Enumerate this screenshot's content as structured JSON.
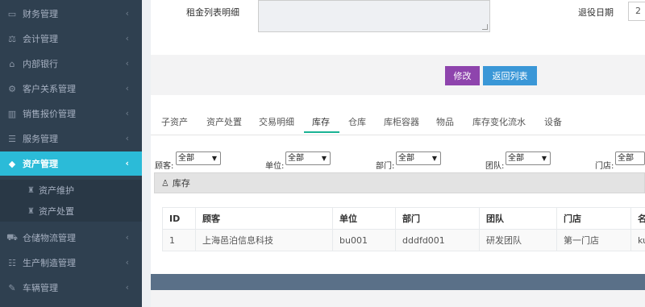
{
  "sidebar": {
    "items": [
      {
        "label": "财务管理",
        "icon": "money-icon"
      },
      {
        "label": "会计管理",
        "icon": "scale-icon"
      },
      {
        "label": "内部银行",
        "icon": "bank-icon"
      },
      {
        "label": "客户关系管理",
        "icon": "gears-icon"
      },
      {
        "label": "销售报价管理",
        "icon": "bar-chart-icon"
      },
      {
        "label": "服务管理",
        "icon": "list-icon"
      },
      {
        "label": "资产管理",
        "icon": "diamond-icon"
      },
      {
        "label": "仓储物流管理",
        "icon": "truck-icon"
      },
      {
        "label": "生产制造管理",
        "icon": "sliders-icon"
      },
      {
        "label": "车辆管理",
        "icon": "edit-icon"
      }
    ],
    "subitems": [
      {
        "label": "资产维护",
        "icon": "trophy-icon"
      },
      {
        "label": "资产处置",
        "icon": "trophy-icon"
      }
    ],
    "chevron": "‹"
  },
  "form": {
    "rent_detail_label": "租金列表明细",
    "retire_date_label": "退役日期",
    "retire_date_value": "2"
  },
  "actions": {
    "edit": "修改",
    "back": "返回列表"
  },
  "tabs": [
    "子资产",
    "资产处置",
    "交易明细",
    "库存",
    "仓库",
    "库柜容器",
    "物品",
    "库存变化流水",
    "设备"
  ],
  "active_tab": "库存",
  "filters": [
    {
      "label": "顾客:",
      "value": "全部"
    },
    {
      "label": "单位:",
      "value": "全部"
    },
    {
      "label": "部门:",
      "value": "全部"
    },
    {
      "label": "团队:",
      "value": "全部"
    },
    {
      "label": "门店:",
      "value": "全部"
    }
  ],
  "panel": {
    "title": "库存"
  },
  "table": {
    "columns": [
      "ID",
      "顾客",
      "单位",
      "部门",
      "团队",
      "门店",
      "名"
    ],
    "rows": [
      [
        "1",
        "上海邑泊信息科技",
        "bu001",
        "dddfd001",
        "研发团队",
        "第一门店",
        "ku"
      ]
    ]
  },
  "colors": {
    "sidebar_bg": "#2f4050",
    "active_item": "#2bbbd8",
    "edit_button": "#8e44ad",
    "back_button": "#3a97d7",
    "tab_underline": "#1ab394"
  }
}
